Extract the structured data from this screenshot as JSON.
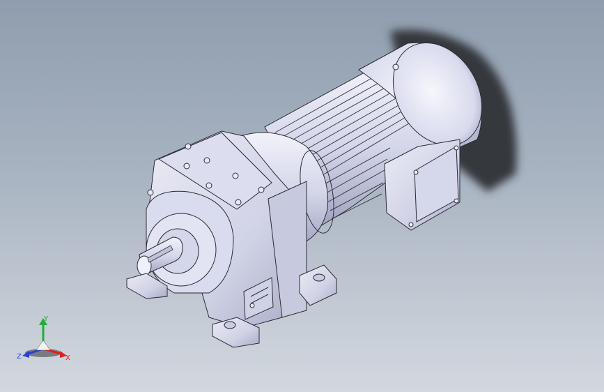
{
  "viewport": {
    "background_top": "#8f9dae",
    "background_bottom": "#d3d8df",
    "model_color": "#d6d7ea",
    "shadow_color": "#3a3d42"
  },
  "triad": {
    "x_label": "X",
    "y_label": "Y",
    "z_label": "Z",
    "x_color": "#e02020",
    "y_color": "#1fae3a",
    "z_color": "#2b3fd6"
  }
}
